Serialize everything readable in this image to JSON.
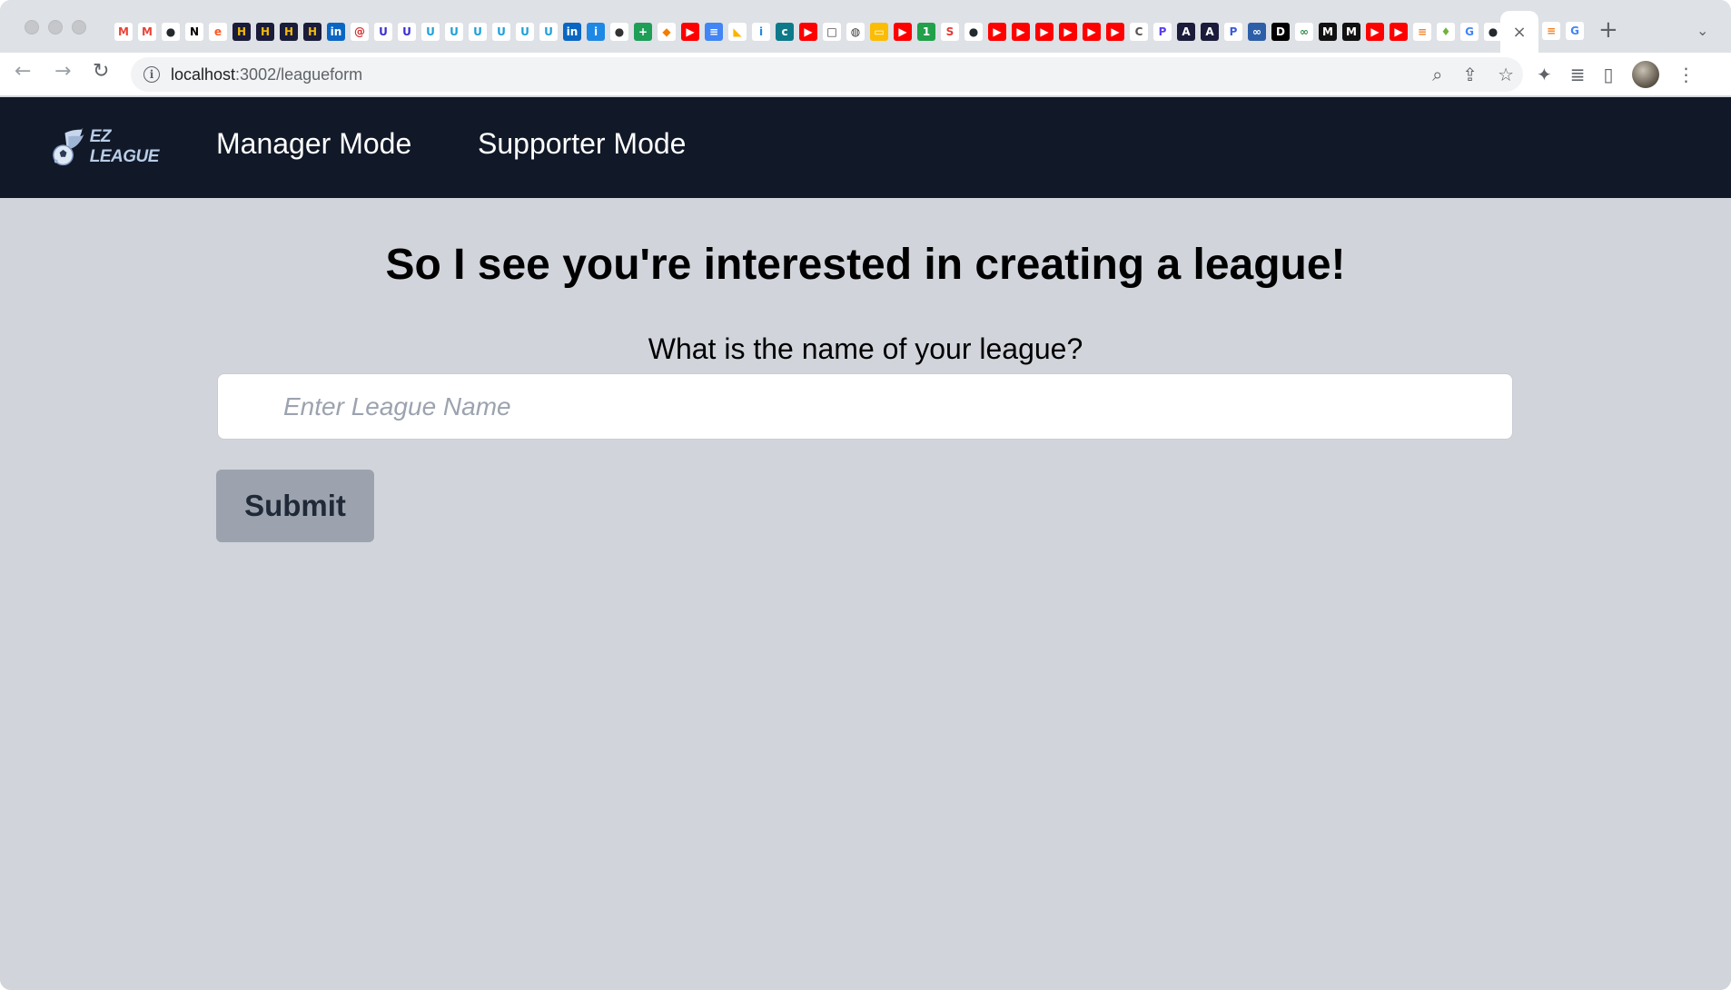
{
  "browser": {
    "url_host": "localhost",
    "url_path": ":3002/leagueform",
    "close_tab_glyph": "×",
    "new_tab_glyph": "+",
    "tab_menu_glyph": "⌄",
    "favicons": [
      {
        "name": "gmail-icon",
        "glyph": "M",
        "bg": "#ffffff",
        "fg": "#ea4335"
      },
      {
        "name": "gmail-icon",
        "glyph": "M",
        "bg": "#ffffff",
        "fg": "#ea4335"
      },
      {
        "name": "github-icon",
        "glyph": "●",
        "bg": "#ffffff",
        "fg": "#24292e"
      },
      {
        "name": "notion-icon",
        "glyph": "N",
        "bg": "#ffffff",
        "fg": "#000000"
      },
      {
        "name": "e-icon",
        "glyph": "e",
        "bg": "#ffffff",
        "fg": "#ff5722"
      },
      {
        "name": "hackerrank-icon",
        "glyph": "H",
        "bg": "#1b1b3a",
        "fg": "#f0b90b"
      },
      {
        "name": "hackerrank-icon",
        "glyph": "H",
        "bg": "#1b1b3a",
        "fg": "#f0b90b"
      },
      {
        "name": "hackerrank-icon",
        "glyph": "H",
        "bg": "#1b1b3a",
        "fg": "#f0b90b"
      },
      {
        "name": "hackerrank-icon",
        "glyph": "H",
        "bg": "#1b1b3a",
        "fg": "#f0b90b"
      },
      {
        "name": "linkedin-icon",
        "glyph": "in",
        "bg": "#0a66c2",
        "fg": "#ffffff"
      },
      {
        "name": "cs-icon",
        "glyph": "@",
        "bg": "#ffffff",
        "fg": "#d32f2f"
      },
      {
        "name": "u-icon",
        "glyph": "U",
        "bg": "#ffffff",
        "fg": "#3b2fd1"
      },
      {
        "name": "u-icon",
        "glyph": "U",
        "bg": "#ffffff",
        "fg": "#3b2fd1"
      },
      {
        "name": "u-icon",
        "glyph": "U",
        "bg": "#ffffff",
        "fg": "#1fa0d8"
      },
      {
        "name": "u-icon",
        "glyph": "U",
        "bg": "#ffffff",
        "fg": "#1fa0d8"
      },
      {
        "name": "u-icon",
        "glyph": "U",
        "bg": "#ffffff",
        "fg": "#1fa0d8"
      },
      {
        "name": "u-icon",
        "glyph": "U",
        "bg": "#ffffff",
        "fg": "#1fa0d8"
      },
      {
        "name": "u-icon",
        "glyph": "U",
        "bg": "#ffffff",
        "fg": "#1fa0d8"
      },
      {
        "name": "u-icon",
        "glyph": "U",
        "bg": "#ffffff",
        "fg": "#1fa0d8"
      },
      {
        "name": "linkedin-icon",
        "glyph": "in",
        "bg": "#0a66c2",
        "fg": "#ffffff"
      },
      {
        "name": "info-tile-icon",
        "glyph": "i",
        "bg": "#1e88e5",
        "fg": "#ffffff"
      },
      {
        "name": "circle-icon",
        "glyph": "●",
        "bg": "#ffffff",
        "fg": "#333333"
      },
      {
        "name": "plus-tile-icon",
        "glyph": "+",
        "bg": "#1e9e57",
        "fg": "#ffffff"
      },
      {
        "name": "flame-icon",
        "glyph": "◆",
        "bg": "#ffffff",
        "fg": "#f57c00"
      },
      {
        "name": "youtube-icon",
        "glyph": "▶",
        "bg": "#ff0000",
        "fg": "#ffffff"
      },
      {
        "name": "docs-icon",
        "glyph": "≡",
        "bg": "#4285f4",
        "fg": "#ffffff"
      },
      {
        "name": "airtable-icon",
        "glyph": "◣",
        "bg": "#ffffff",
        "fg": "#fcb400"
      },
      {
        "name": "info-icon",
        "glyph": "i",
        "bg": "#ffffff",
        "fg": "#1e88e5"
      },
      {
        "name": "c-icon",
        "glyph": "c",
        "bg": "#0d7a8a",
        "fg": "#ffffff"
      },
      {
        "name": "youtube-icon",
        "glyph": "▶",
        "bg": "#ff0000",
        "fg": "#ffffff"
      },
      {
        "name": "square-icon",
        "glyph": "□",
        "bg": "#ffffff",
        "fg": "#333333"
      },
      {
        "name": "globe-icon",
        "glyph": "◍",
        "bg": "#ffffff",
        "fg": "#333333"
      },
      {
        "name": "slides-icon",
        "glyph": "▭",
        "bg": "#fbbc04",
        "fg": "#ffffff"
      },
      {
        "name": "youtube-icon",
        "glyph": "▶",
        "bg": "#ff0000",
        "fg": "#ffffff"
      },
      {
        "name": "green-circle-icon",
        "glyph": "1",
        "bg": "#22a04b",
        "fg": "#ffffff"
      },
      {
        "name": "s-icon",
        "glyph": "S",
        "bg": "#ffffff",
        "fg": "#e53935"
      },
      {
        "name": "github-icon",
        "glyph": "●",
        "bg": "#ffffff",
        "fg": "#24292e"
      },
      {
        "name": "youtube-icon",
        "glyph": "▶",
        "bg": "#ff0000",
        "fg": "#ffffff"
      },
      {
        "name": "youtube-icon",
        "glyph": "▶",
        "bg": "#ff0000",
        "fg": "#ffffff"
      },
      {
        "name": "youtube-icon",
        "glyph": "▶",
        "bg": "#ff0000",
        "fg": "#ffffff"
      },
      {
        "name": "youtube-icon",
        "glyph": "▶",
        "bg": "#ff0000",
        "fg": "#ffffff"
      },
      {
        "name": "youtube-icon",
        "glyph": "▶",
        "bg": "#ff0000",
        "fg": "#ffffff"
      },
      {
        "name": "youtube-icon",
        "glyph": "▶",
        "bg": "#ff0000",
        "fg": "#ffffff"
      },
      {
        "name": "chrome-c-icon",
        "glyph": "C",
        "bg": "#ffffff",
        "fg": "#555555"
      },
      {
        "name": "p-icon",
        "glyph": "P",
        "bg": "#ffffff",
        "fg": "#5b3df5"
      },
      {
        "name": "a-icon",
        "glyph": "A",
        "bg": "#1b1b3a",
        "fg": "#ffffff"
      },
      {
        "name": "a-icon",
        "glyph": "A",
        "bg": "#1b1b3a",
        "fg": "#ffffff"
      },
      {
        "name": "p-italic-icon",
        "glyph": "P",
        "bg": "#ffffff",
        "fg": "#3b5bdb"
      },
      {
        "name": "infinity-icon",
        "glyph": "∞",
        "bg": "#2d5fa8",
        "fg": "#ffffff"
      },
      {
        "name": "dev-icon",
        "glyph": "D",
        "bg": "#000000",
        "fg": "#ffffff"
      },
      {
        "name": "gfg-icon",
        "glyph": "∞",
        "bg": "#ffffff",
        "fg": "#2f8d46"
      },
      {
        "name": "medium-icon",
        "glyph": "M",
        "bg": "#111111",
        "fg": "#ffffff"
      },
      {
        "name": "medium-icon",
        "glyph": "M",
        "bg": "#111111",
        "fg": "#ffffff"
      },
      {
        "name": "youtube-icon",
        "glyph": "▶",
        "bg": "#ff0000",
        "fg": "#ffffff"
      },
      {
        "name": "youtube-icon",
        "glyph": "▶",
        "bg": "#ff0000",
        "fg": "#ffffff"
      },
      {
        "name": "stackoverflow-icon",
        "glyph": "≡",
        "bg": "#ffffff",
        "fg": "#f48024"
      },
      {
        "name": "leaf-icon",
        "glyph": "♦",
        "bg": "#ffffff",
        "fg": "#6db33f"
      },
      {
        "name": "google-icon",
        "glyph": "G",
        "bg": "#ffffff",
        "fg": "#4285f4"
      },
      {
        "name": "github-icon",
        "glyph": "●",
        "bg": "#ffffff",
        "fg": "#24292e"
      }
    ],
    "tail_favicons": [
      {
        "name": "stackoverflow-icon",
        "glyph": "≡",
        "bg": "#ffffff",
        "fg": "#f48024"
      },
      {
        "name": "google-icon",
        "glyph": "G",
        "bg": "#ffffff",
        "fg": "#4285f4"
      }
    ]
  },
  "app": {
    "logo_text": "EZ LEAGUE",
    "nav": {
      "manager": "Manager Mode",
      "supporter": "Supporter Mode"
    },
    "colors": {
      "navbar": "#111827",
      "page_bg": "#d1d5db",
      "button_bg": "#9ca3af"
    }
  },
  "form": {
    "heading": "So I see you're interested in creating a league!",
    "question": "What is the name of your league?",
    "input_placeholder": "Enter League Name",
    "input_value": "",
    "submit_label": "Submit"
  }
}
